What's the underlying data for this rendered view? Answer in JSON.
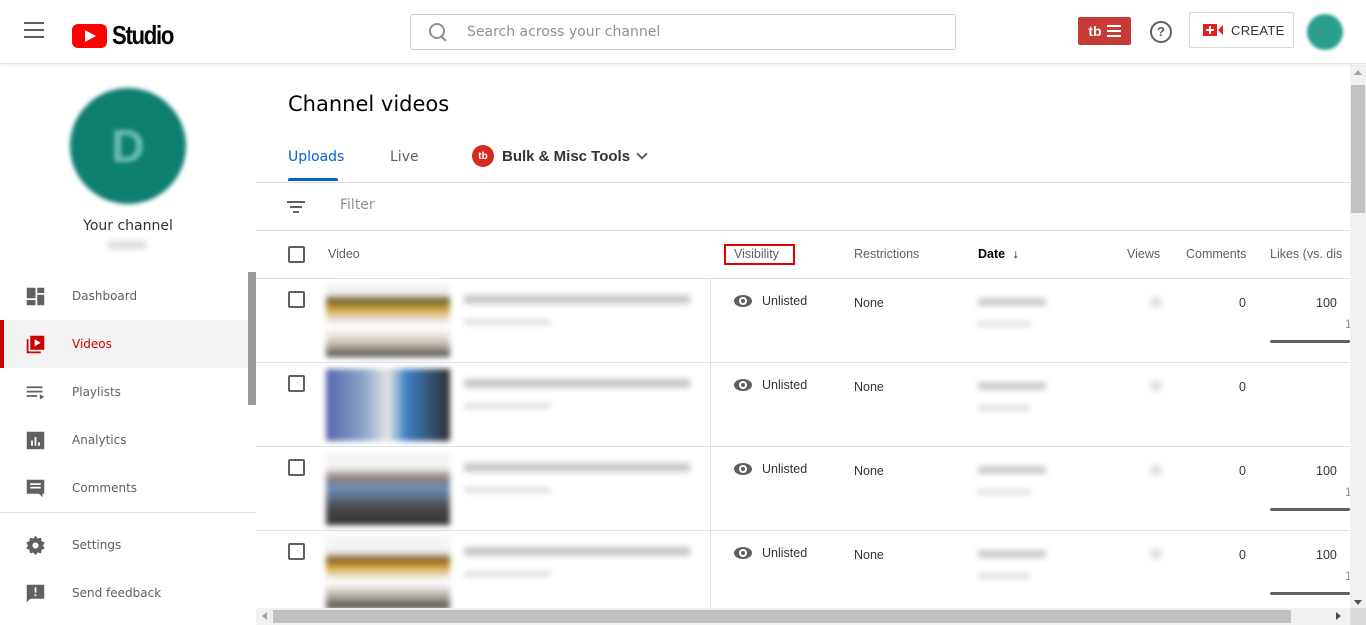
{
  "header": {
    "app_name": "Studio",
    "search_placeholder": "Search across your channel",
    "tubebuddy_label": "tb",
    "help_label": "?",
    "create_label": "CREATE"
  },
  "sidebar": {
    "avatar_letter": "D",
    "channel_label": "Your channel",
    "items": [
      {
        "label": "Dashboard",
        "icon": "dashboard-icon",
        "active": false
      },
      {
        "label": "Videos",
        "icon": "videos-icon",
        "active": true
      },
      {
        "label": "Playlists",
        "icon": "playlists-icon",
        "active": false
      },
      {
        "label": "Analytics",
        "icon": "analytics-icon",
        "active": false
      },
      {
        "label": "Comments",
        "icon": "comments-icon",
        "active": false
      }
    ],
    "bottom_items": [
      {
        "label": "Settings",
        "icon": "settings-icon"
      },
      {
        "label": "Send feedback",
        "icon": "feedback-icon"
      }
    ]
  },
  "main": {
    "page_title": "Channel videos",
    "tabs": [
      {
        "label": "Uploads",
        "active": true
      },
      {
        "label": "Live",
        "active": false
      }
    ],
    "tubebuddy_tab": {
      "logo": "tb",
      "label": "Bulk & Misc Tools"
    },
    "filter_placeholder": "Filter",
    "columns": {
      "video": "Video",
      "visibility": "Visibility",
      "restrictions": "Restrictions",
      "date": "Date",
      "date_sort": "↓",
      "views": "Views",
      "comments": "Comments",
      "likes": "Likes (vs. dis"
    },
    "rows": [
      {
        "visibility": "Unlisted",
        "restrictions": "None",
        "comments": "0",
        "likes_pct": "100",
        "likes_count": "1",
        "likes_ratio": 1.0,
        "has_likes": true
      },
      {
        "visibility": "Unlisted",
        "restrictions": "None",
        "comments": "0",
        "likes_pct": "",
        "likes_count": "",
        "likes_ratio": 0,
        "has_likes": false
      },
      {
        "visibility": "Unlisted",
        "restrictions": "None",
        "comments": "0",
        "likes_pct": "100",
        "likes_count": "1",
        "likes_ratio": 1.0,
        "has_likes": true
      },
      {
        "visibility": "Unlisted",
        "restrictions": "None",
        "comments": "0",
        "likes_pct": "100",
        "likes_count": "1",
        "likes_ratio": 1.0,
        "has_likes": true
      }
    ]
  },
  "colors": {
    "brand_red": "#ff0000",
    "active_nav": "#cc0000",
    "tab_blue": "#065fd4",
    "tubebuddy_red": "#c73a36",
    "highlight_box": "#e00000",
    "avatar_teal": "#0d7f71"
  }
}
